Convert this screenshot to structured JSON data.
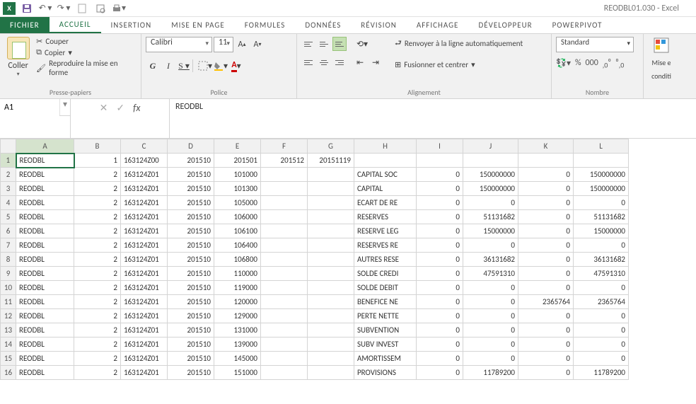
{
  "app_title": "REODBL01.030 - Excel",
  "tabs": {
    "file": "FICHIER",
    "items": [
      "ACCUEIL",
      "INSERTION",
      "MISE EN PAGE",
      "FORMULES",
      "DONNÉES",
      "RÉVISION",
      "AFFICHAGE",
      "DÉVELOPPEUR",
      "POWERPIVOT"
    ],
    "active": 0
  },
  "ribbon": {
    "clipboard": {
      "paste": "Coller",
      "cut": "Couper",
      "copy": "Copier",
      "format": "Reproduire la mise en forme",
      "label": "Presse-papiers"
    },
    "font": {
      "name": "Calibri",
      "size": "11",
      "label": "Police"
    },
    "align": {
      "wrap": "Renvoyer à la ligne automatiquement",
      "merge": "Fusionner et centrer",
      "label": "Alignement"
    },
    "number": {
      "format": "Standard",
      "label": "Nombre"
    },
    "styles": {
      "cond": "Mise e",
      "cond2": "conditi"
    }
  },
  "namebox": "A1",
  "formula": "REODBL",
  "columns": [
    "A",
    "B",
    "C",
    "D",
    "E",
    "F",
    "G",
    "H",
    "I",
    "J",
    "K",
    "L"
  ],
  "rows": [
    {
      "n": 1,
      "A": "REODBL",
      "B": "1",
      "C": "163124Z00",
      "D": "201510",
      "E": "201501",
      "F": "201512",
      "G": "20151119",
      "H": "",
      "I": "",
      "J": "",
      "K": "",
      "L": ""
    },
    {
      "n": 2,
      "A": "REODBL",
      "B": "2",
      "C": "163124Z01",
      "D": "201510",
      "E": "101000",
      "F": "",
      "G": "",
      "H": "CAPITAL SOC",
      "I": "0",
      "J": "150000000",
      "K": "0",
      "L": "150000000"
    },
    {
      "n": 3,
      "A": "REODBL",
      "B": "2",
      "C": "163124Z01",
      "D": "201510",
      "E": "101300",
      "F": "",
      "G": "",
      "H": "CAPITAL",
      "I": "0",
      "J": "150000000",
      "K": "0",
      "L": "150000000"
    },
    {
      "n": 4,
      "A": "REODBL",
      "B": "2",
      "C": "163124Z01",
      "D": "201510",
      "E": "105000",
      "F": "",
      "G": "",
      "H": "ECART DE RE",
      "I": "0",
      "J": "0",
      "K": "0",
      "L": "0"
    },
    {
      "n": 5,
      "A": "REODBL",
      "B": "2",
      "C": "163124Z01",
      "D": "201510",
      "E": "106000",
      "F": "",
      "G": "",
      "H": "RESERVES",
      "I": "0",
      "J": "51131682",
      "K": "0",
      "L": "51131682"
    },
    {
      "n": 6,
      "A": "REODBL",
      "B": "2",
      "C": "163124Z01",
      "D": "201510",
      "E": "106100",
      "F": "",
      "G": "",
      "H": "RESERVE LEG",
      "I": "0",
      "J": "15000000",
      "K": "0",
      "L": "15000000"
    },
    {
      "n": 7,
      "A": "REODBL",
      "B": "2",
      "C": "163124Z01",
      "D": "201510",
      "E": "106400",
      "F": "",
      "G": "",
      "H": "RESERVES RE",
      "I": "0",
      "J": "0",
      "K": "0",
      "L": "0"
    },
    {
      "n": 8,
      "A": "REODBL",
      "B": "2",
      "C": "163124Z01",
      "D": "201510",
      "E": "106800",
      "F": "",
      "G": "",
      "H": "AUTRES RESE",
      "I": "0",
      "J": "36131682",
      "K": "0",
      "L": "36131682"
    },
    {
      "n": 9,
      "A": "REODBL",
      "B": "2",
      "C": "163124Z01",
      "D": "201510",
      "E": "110000",
      "F": "",
      "G": "",
      "H": "SOLDE CREDI",
      "I": "0",
      "J": "47591310",
      "K": "0",
      "L": "47591310"
    },
    {
      "n": 10,
      "A": "REODBL",
      "B": "2",
      "C": "163124Z01",
      "D": "201510",
      "E": "119000",
      "F": "",
      "G": "",
      "H": "SOLDE DEBIT",
      "I": "0",
      "J": "0",
      "K": "0",
      "L": "0"
    },
    {
      "n": 11,
      "A": "REODBL",
      "B": "2",
      "C": "163124Z01",
      "D": "201510",
      "E": "120000",
      "F": "",
      "G": "",
      "H": "BENEFICE NE",
      "I": "0",
      "J": "0",
      "K": "2365764",
      "L": "2365764"
    },
    {
      "n": 12,
      "A": "REODBL",
      "B": "2",
      "C": "163124Z01",
      "D": "201510",
      "E": "129000",
      "F": "",
      "G": "",
      "H": "PERTE NETTE",
      "I": "0",
      "J": "0",
      "K": "0",
      "L": "0"
    },
    {
      "n": 13,
      "A": "REODBL",
      "B": "2",
      "C": "163124Z01",
      "D": "201510",
      "E": "131000",
      "F": "",
      "G": "",
      "H": "SUBVENTION",
      "I": "0",
      "J": "0",
      "K": "0",
      "L": "0"
    },
    {
      "n": 14,
      "A": "REODBL",
      "B": "2",
      "C": "163124Z01",
      "D": "201510",
      "E": "139000",
      "F": "",
      "G": "",
      "H": "SUBV INVEST",
      "I": "0",
      "J": "0",
      "K": "0",
      "L": "0"
    },
    {
      "n": 15,
      "A": "REODBL",
      "B": "2",
      "C": "163124Z01",
      "D": "201510",
      "E": "145000",
      "F": "",
      "G": "",
      "H": "AMORTISSEM",
      "I": "0",
      "J": "0",
      "K": "0",
      "L": "0"
    },
    {
      "n": 16,
      "A": "REODBL",
      "B": "2",
      "C": "163124Z01",
      "D": "201510",
      "E": "151000",
      "F": "",
      "G": "",
      "H": "PROVISIONS",
      "I": "0",
      "J": "11789200",
      "K": "0",
      "L": "11789200"
    }
  ]
}
